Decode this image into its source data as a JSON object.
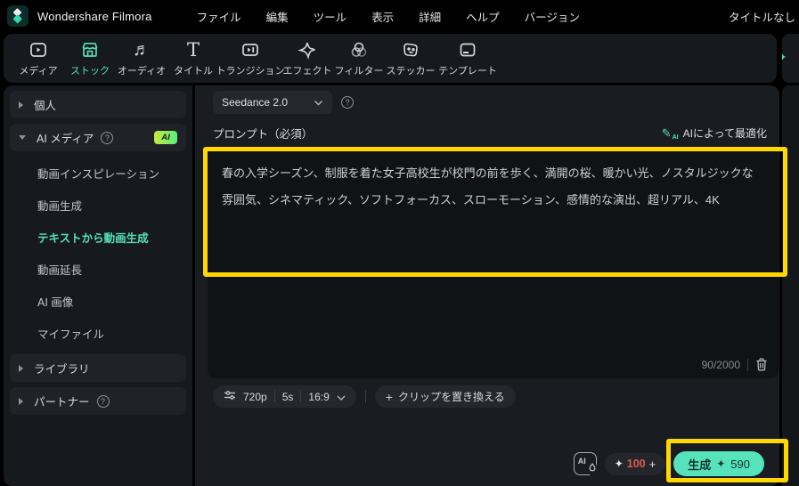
{
  "app": {
    "title": "Wondershare Filmora",
    "project_title": "タイトルなし"
  },
  "menubar": {
    "items": [
      "ファイル",
      "編集",
      "ツール",
      "表示",
      "詳細",
      "ヘルプ",
      "バージョン"
    ]
  },
  "toolbar": {
    "items": [
      "メディア",
      "ストック",
      "オーディオ",
      "タイトル",
      "トランジション",
      "エフェクト",
      "フィルター",
      "ステッカー",
      "テンプレート"
    ],
    "active": "ストック"
  },
  "sidebar": {
    "personal": "個人",
    "ai_media": "AI メディア",
    "ai_badge": "AI",
    "items": [
      "動画インスピレーション",
      "動画生成",
      "テキストから動画生成",
      "動画延長",
      "AI 画像",
      "マイファイル"
    ],
    "active_item": "テキストから動画生成",
    "library": "ライブラリ",
    "partner": "パートナー"
  },
  "main": {
    "model": {
      "value": "Seedance 2.0"
    },
    "prompt": {
      "label": "プロンプト（必須）",
      "optimize": "AIによって最適化",
      "value": "春の入学シーズン、制服を着た女子高校生が校門の前を歩く、満開の桜、暖かい光、ノスタルジックな雰囲気、シネマティック、ソフトフォーカス、スローモーション、感情的な演出、超リアル、4K",
      "counter": "90/2000"
    },
    "settings": {
      "resolution": "720p",
      "duration": "5s",
      "ratio": "16:9"
    },
    "replace_clip": "クリップを置き換える",
    "footer": {
      "credits": "100",
      "plus": "+",
      "generate": "生成",
      "cost": "590"
    }
  },
  "icons": {
    "help": "?",
    "sparkle": "✦",
    "plus": "+",
    "ai": "AI",
    "pencil": "✎"
  },
  "colors": {
    "accent": "#53e2b5",
    "annotation": "#ffd800",
    "credits": "#e2594a",
    "badge_gradient": [
      "#c9e93a",
      "#57ef81"
    ],
    "generate_bg": "#54e3ba"
  }
}
